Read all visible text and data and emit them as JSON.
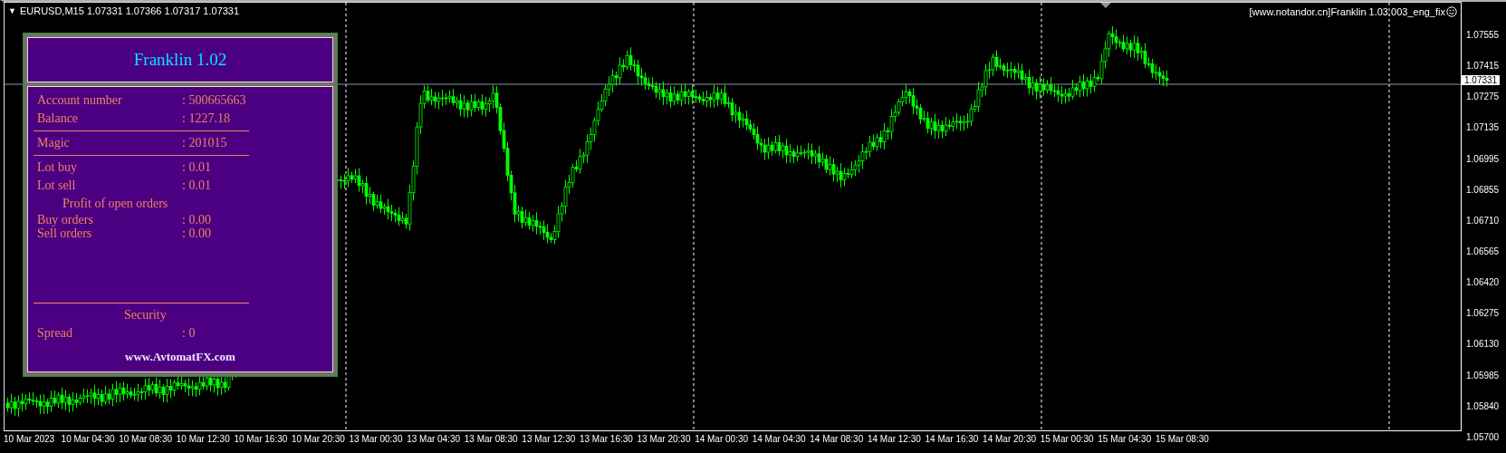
{
  "chart": {
    "symbol_caret": "▼",
    "title": "EURUSD,M15  1.07331 1.07366 1.07317 1.07331",
    "expert_label": "[www.notandor.cn]Franklin 1.03.003_eng_fix",
    "current_price": "1.07331",
    "price_labels": [
      "1.07555",
      "1.07415",
      "1.07275",
      "1.07135",
      "1.06995",
      "1.06855",
      "1.06710",
      "1.06565",
      "1.06420",
      "1.06275",
      "1.06130",
      "1.05985",
      "1.05840",
      "1.05700"
    ],
    "time_labels": [
      "10 Mar 2023",
      "10 Mar 04:30",
      "10 Mar 08:30",
      "10 Mar 12:30",
      "10 Mar 16:30",
      "10 Mar 20:30",
      "13 Mar 00:30",
      "13 Mar 04:30",
      "13 Mar 08:30",
      "13 Mar 12:30",
      "13 Mar 16:30",
      "13 Mar 20:30",
      "14 Mar 00:30",
      "14 Mar 04:30",
      "14 Mar 08:30",
      "14 Mar 12:30",
      "14 Mar 16:30",
      "14 Mar 20:30",
      "15 Mar 00:30",
      "15 Mar 04:30",
      "15 Mar 08:30"
    ]
  },
  "panel": {
    "title": "Franklin 1.02",
    "sections": [
      {
        "rows": [
          {
            "kind": "field",
            "label": "Account number",
            "value": ": 500665663"
          },
          {
            "kind": "field",
            "label": "Balance",
            "value": ": 1227.18"
          },
          {
            "kind": "rule"
          },
          {
            "kind": "field",
            "label": "Magic",
            "value": ": 201015"
          },
          {
            "kind": "rule"
          },
          {
            "kind": "field",
            "label": "Lot buy",
            "value": ": 0.01"
          },
          {
            "kind": "field",
            "label": "Lot sell",
            "value": ": 0.01"
          },
          {
            "kind": "heading",
            "label": "Profit of open orders"
          },
          {
            "kind": "tight",
            "label": "Buy orders",
            "value": ": 0.00"
          },
          {
            "kind": "tight",
            "label": "Sell orders",
            "value": ": 0.00"
          }
        ]
      },
      {
        "rows": [
          {
            "kind": "rule"
          },
          {
            "kind": "heading",
            "label": "Security"
          },
          {
            "kind": "field",
            "label": "Spread",
            "value": ": 0"
          }
        ]
      }
    ],
    "footer": "www.AvtomatFX.com"
  }
}
